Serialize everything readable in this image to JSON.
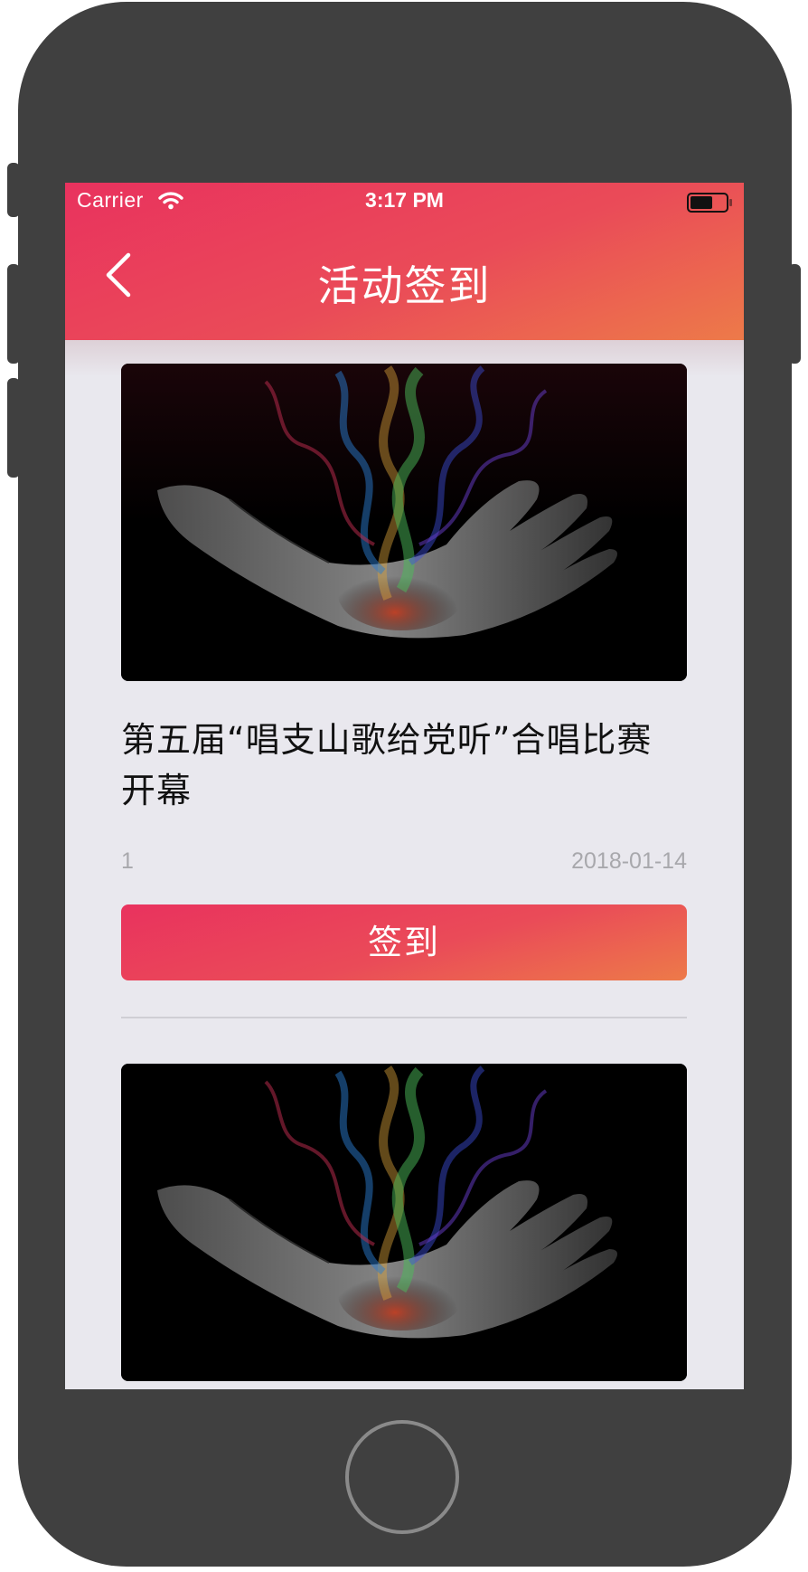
{
  "status_bar": {
    "carrier": "Carrier",
    "time": "3:17 PM",
    "wifi_icon": "wifi-icon",
    "battery_icon": "battery-icon"
  },
  "nav": {
    "title": "活动签到",
    "back_icon": "chevron-left-icon"
  },
  "colors": {
    "accent_start": "#e9325e",
    "accent_end": "#ed7a49",
    "background": "#e9e8ee",
    "meta_text": "#a8a8ac"
  },
  "activities": [
    {
      "image": "hand-with-rainbow-smoke-image",
      "title": "第五届“唱支山歌给党听”合唱比赛开幕",
      "count": "1",
      "date": "2018-01-14",
      "button_label": "签到"
    },
    {
      "image": "hand-with-rainbow-smoke-image"
    }
  ]
}
